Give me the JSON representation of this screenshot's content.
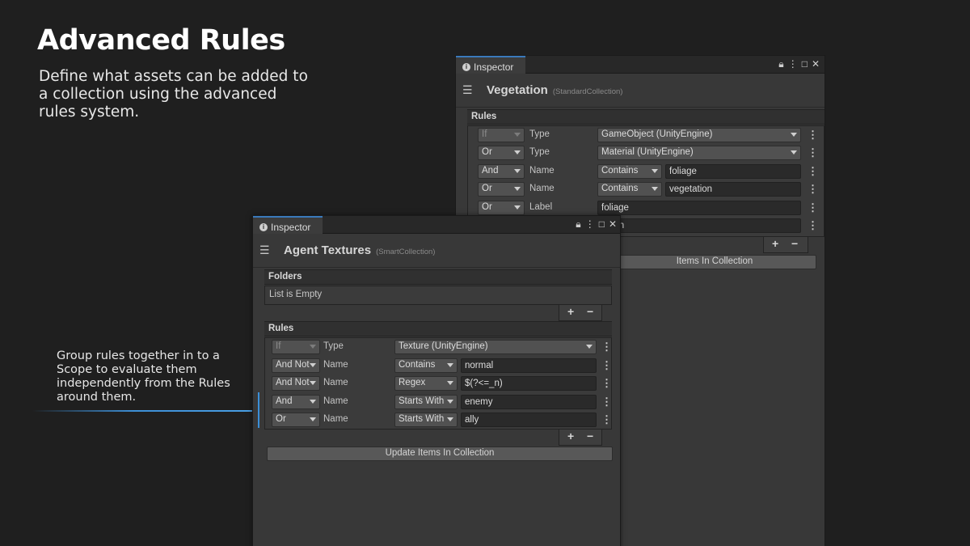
{
  "slide": {
    "title": "Advanced Rules",
    "subtitle": "Define what assets can be added to a collection using the advanced rules system.",
    "callout": "Group rules together in to a Scope to evaluate them independently from the Rules around them."
  },
  "colors": {
    "accent": "#3b8fd8",
    "background": "#1f1f1f",
    "panel": "#383838"
  },
  "back_window": {
    "tab_label": "Inspector",
    "controls": [
      "lock-icon",
      "more-icon",
      "maximize-icon",
      "close-icon"
    ],
    "title": "Vegetation",
    "type": "(StandardCollection)",
    "rules_header": "Rules",
    "rules": [
      {
        "op": "If",
        "op_dim": true,
        "field": "Type",
        "value": "GameObject (UnityEngine)"
      },
      {
        "op": "Or",
        "field": "Type",
        "value": "Material (UnityEngine)"
      },
      {
        "op": "And",
        "field": "Name",
        "condition": "Contains",
        "text": "foliage"
      },
      {
        "op": "Or",
        "field": "Name",
        "condition": "Contains",
        "text": "vegetation"
      },
      {
        "op": "Or",
        "field": "Label",
        "text": "foliage"
      },
      {
        "text": "tation"
      }
    ],
    "update_label": "Items In Collection"
  },
  "front_window": {
    "tab_label": "Inspector",
    "title": "Agent Textures",
    "type": "(SmartCollection)",
    "folders_header": "Folders",
    "folders_empty": "List is Empty",
    "rules_header": "Rules",
    "rules": [
      {
        "op": "If",
        "op_dim": true,
        "field": "Type",
        "value": "Texture (UnityEngine)"
      },
      {
        "op": "And Not",
        "field": "Name",
        "condition": "Contains",
        "text": "normal"
      },
      {
        "op": "And Not",
        "field": "Name",
        "condition": "Regex",
        "text": "$(?<=_n)"
      },
      {
        "op": "And",
        "field": "Name",
        "condition": "Starts With",
        "text": "enemy"
      },
      {
        "op": "Or",
        "field": "Name",
        "condition": "Starts With",
        "text": "ally"
      }
    ],
    "plus": "+",
    "minus": "−",
    "update_label": "Update Items In Collection"
  }
}
